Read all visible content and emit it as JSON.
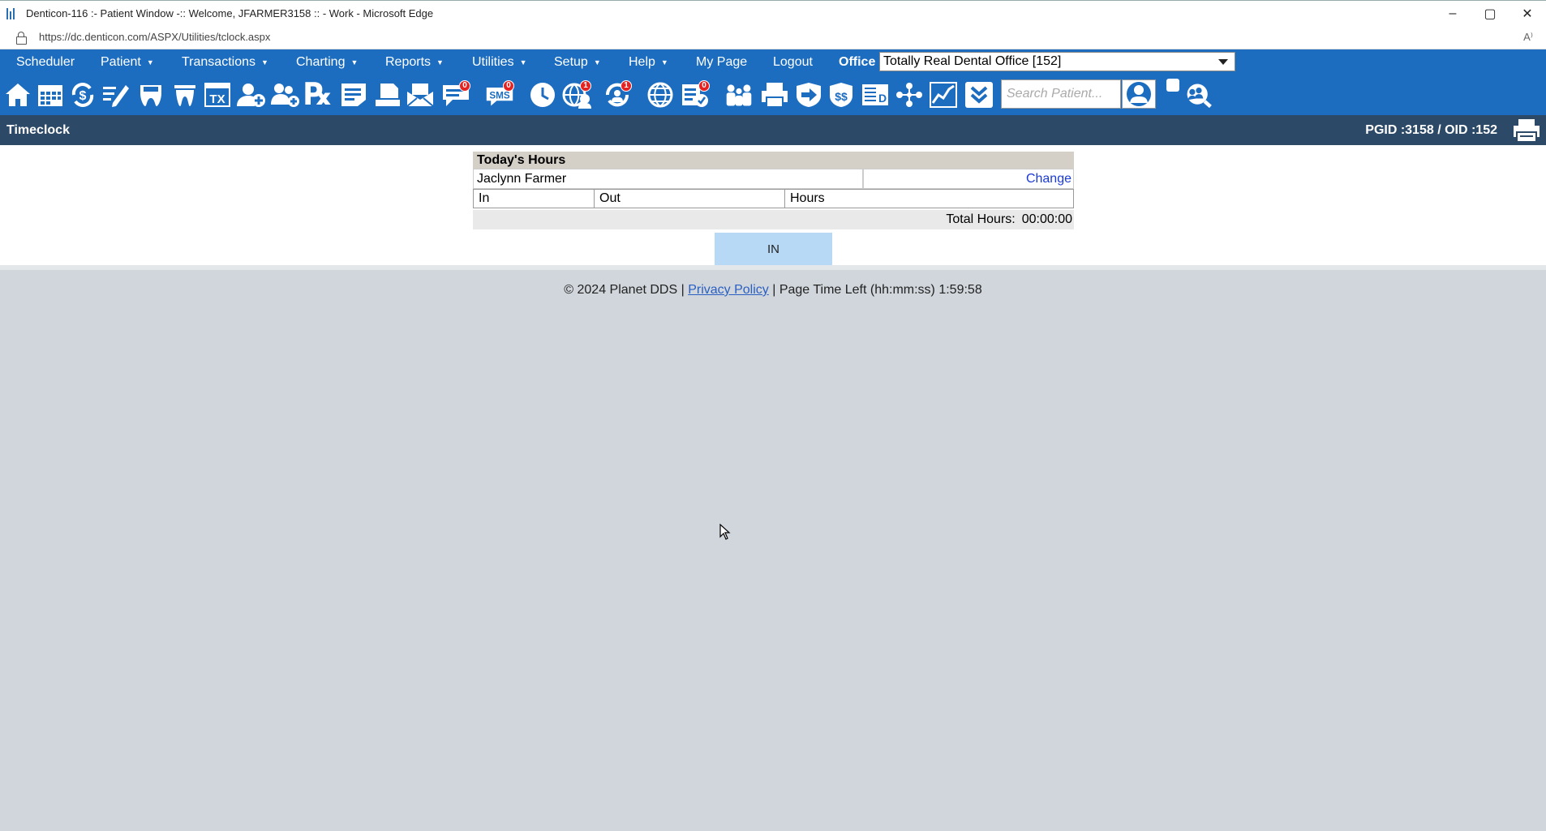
{
  "window": {
    "title": "Denticon-116 :- Patient Window -:: Welcome, JFARMER3158 :: - Work - Microsoft Edge",
    "controls": [
      "–",
      "▢",
      "✕"
    ]
  },
  "browser": {
    "url": "https://dc.denticon.com/ASPX/Utilities/tclock.aspx",
    "read_aloud": "A⁾"
  },
  "menu": {
    "items": [
      {
        "label": "Scheduler",
        "caret": false
      },
      {
        "label": "Patient",
        "caret": true
      },
      {
        "label": "Transactions",
        "caret": true
      },
      {
        "label": "Charting",
        "caret": true
      },
      {
        "label": "Reports",
        "caret": true
      },
      {
        "label": "Utilities",
        "caret": true
      },
      {
        "label": "Setup",
        "caret": true
      },
      {
        "label": "Help",
        "caret": true
      },
      {
        "label": "My Page",
        "caret": false
      },
      {
        "label": "Logout",
        "caret": false
      }
    ],
    "office_label": "Office",
    "office_value": "Totally Real Dental Office [152]"
  },
  "toolbar": {
    "icons": [
      {
        "name": "home-icon"
      },
      {
        "name": "calendar-icon"
      },
      {
        "name": "dollar-transaction-icon"
      },
      {
        "name": "edit-list-icon"
      },
      {
        "name": "tooth-chart-icon"
      },
      {
        "name": "tooth-icon"
      },
      {
        "name": "tx-plan-icon",
        "text": "TX"
      },
      {
        "name": "add-patient-icon"
      },
      {
        "name": "add-family-icon"
      },
      {
        "name": "prescription-icon",
        "text": "℞"
      },
      {
        "name": "notes-icon"
      },
      {
        "name": "documents-icon"
      },
      {
        "name": "mail-icon"
      },
      {
        "name": "messages-icon",
        "badge": "0"
      },
      {
        "name": "sms-icon",
        "text": "SMS",
        "badge": "0"
      },
      {
        "name": "clock-icon"
      },
      {
        "name": "globe-user-icon",
        "badge": "1"
      },
      {
        "name": "sync-icon",
        "badge": "1"
      },
      {
        "name": "web-icon"
      },
      {
        "name": "claims-icon",
        "badge": "0"
      },
      {
        "name": "family-icon"
      },
      {
        "name": "print-icon"
      },
      {
        "name": "forward-arrow-icon"
      },
      {
        "name": "insurance-dollar-icon"
      },
      {
        "name": "ledger-icon"
      },
      {
        "name": "network-icon"
      },
      {
        "name": "chart-line-icon"
      },
      {
        "name": "chevron-double-down-icon"
      }
    ],
    "search_placeholder": "Search Patient..."
  },
  "page": {
    "title": "Timeclock",
    "ids": "PGID :3158  /  OID :152"
  },
  "timeclock": {
    "header": "Today's Hours",
    "user": "Jaclynn Farmer",
    "change_link": "Change",
    "columns": [
      "In",
      "Out",
      "Hours"
    ],
    "total_label": "Total Hours:",
    "total_value": "00:00:00",
    "in_button": "IN"
  },
  "footer": {
    "copyright": "© 2024 Planet DDS |",
    "privacy": "Privacy Policy",
    "time_left": "|  Page Time Left (hh:mm:ss) 1:59:58"
  }
}
